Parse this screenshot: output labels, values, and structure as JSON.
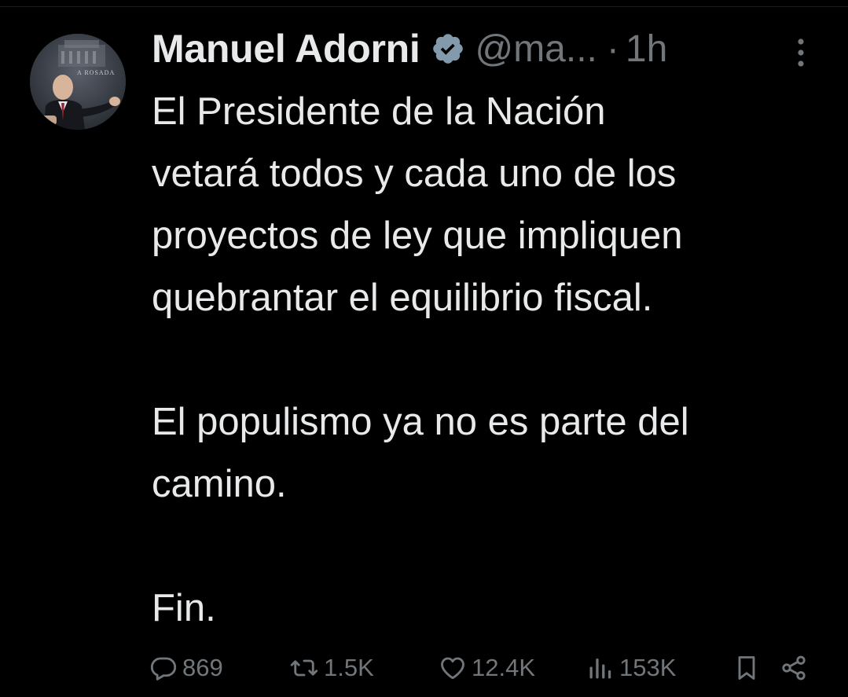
{
  "tweet": {
    "author": {
      "name": "Manuel Adorni",
      "handle": "@ma...",
      "verified_icon": "verified-badge-icon",
      "separator": "·",
      "time": "1h",
      "avatar_caption": "A ROSADA"
    },
    "paragraphs": [
      [
        "El Presidente de la Nación",
        "vetará todos y cada uno de los",
        "proyectos de ley que impliquen",
        "quebrantar el equilibrio fiscal."
      ],
      [
        "El populismo ya no es parte del",
        "camino."
      ],
      [
        "Fin."
      ]
    ],
    "stats": {
      "replies": "869",
      "reposts": "1.5K",
      "likes": "12.4K",
      "views": "153K"
    }
  },
  "icons": {
    "more": "more-icon",
    "reply": "reply-icon",
    "repost": "repost-icon",
    "like": "like-icon",
    "views": "views-icon",
    "bookmark": "bookmark-icon",
    "share": "share-icon"
  },
  "colors": {
    "background": "#000000",
    "text": "#e7e9ea",
    "secondary": "#71767b",
    "verified_badge": "#829aab"
  }
}
